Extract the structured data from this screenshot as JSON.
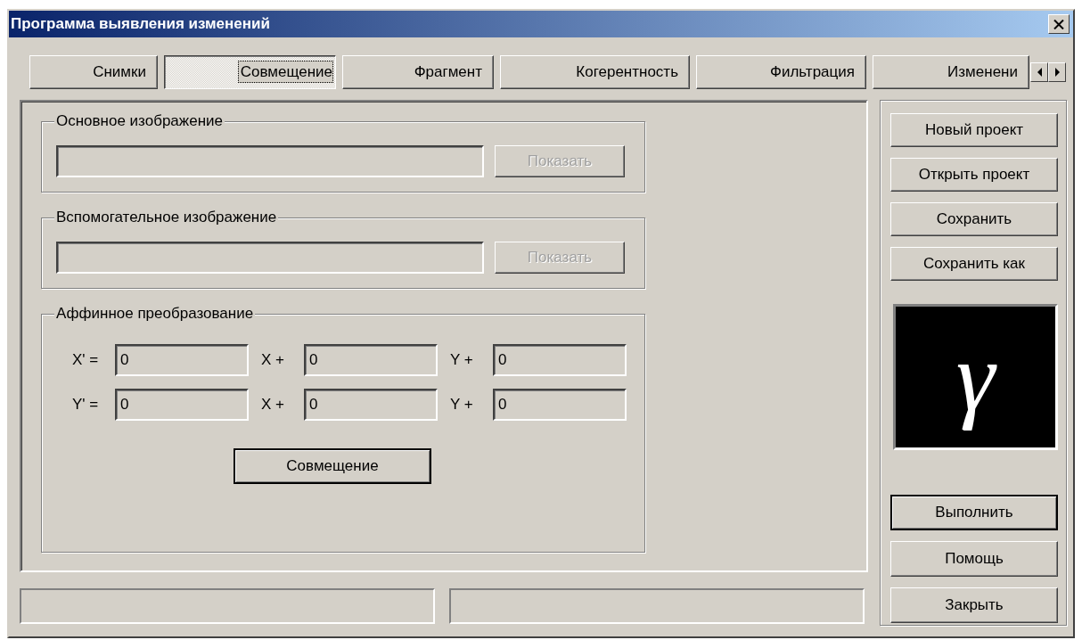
{
  "window": {
    "title": "Программа выявления изменений"
  },
  "tabs": [
    {
      "label": "Снимки",
      "selected": false
    },
    {
      "label": "Совмещение",
      "selected": true
    },
    {
      "label": "Фрагмент",
      "selected": false
    },
    {
      "label": "Когерентность",
      "selected": false
    },
    {
      "label": "Фильтрация",
      "selected": false
    },
    {
      "label": "Изменени",
      "selected": false
    }
  ],
  "image_groups": [
    {
      "title": "Основное изображение",
      "button": {
        "label": "Показать",
        "disabled": true
      }
    },
    {
      "title": "Вспомогательное изображение",
      "button": {
        "label": "Показать",
        "disabled": true
      }
    }
  ],
  "affine": {
    "title": "Аффинное преобразование",
    "rows": [
      {
        "terms": [
          {
            "label": "X' =",
            "value": "0"
          },
          {
            "label": "X +",
            "value": "0"
          },
          {
            "label": "Y +",
            "value": "0"
          }
        ]
      },
      {
        "terms": [
          {
            "label": "Y' =",
            "value": "0"
          },
          {
            "label": "X +",
            "value": "0"
          },
          {
            "label": "Y +",
            "value": "0"
          }
        ]
      }
    ],
    "button": {
      "label": "Совмещение",
      "default": true
    }
  },
  "project_buttons": [
    {
      "label": "Новый проект",
      "default": false
    },
    {
      "label": "Открыть проект",
      "default": false
    },
    {
      "label": "Сохранить",
      "default": false
    },
    {
      "label": "Сохранить как",
      "default": false
    }
  ],
  "logo": {
    "text": "γ"
  },
  "action_buttons": [
    {
      "label": "Выполнить",
      "default": true
    },
    {
      "label": "Помощь",
      "default": false
    },
    {
      "label": "Закрыть",
      "default": false
    }
  ]
}
